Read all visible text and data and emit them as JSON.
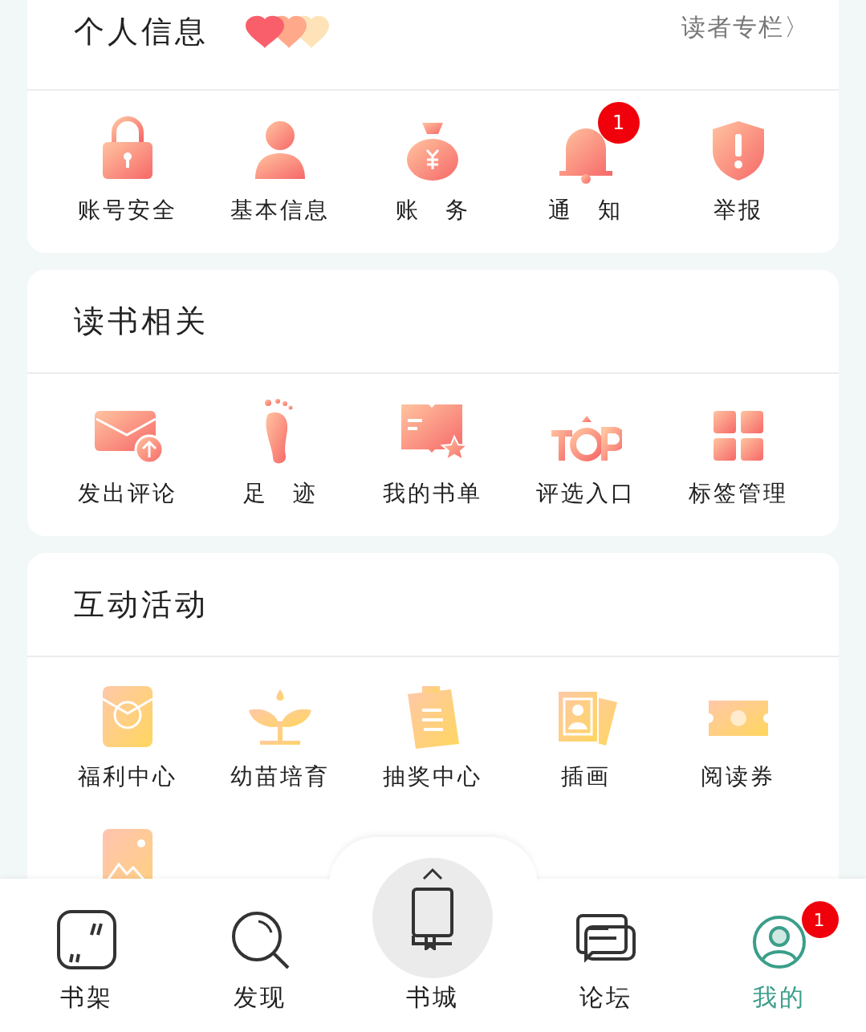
{
  "sections": [
    {
      "title": "个人信息",
      "link": "读者专栏〉",
      "items": [
        {
          "label": "账号安全"
        },
        {
          "label": "基本信息"
        },
        {
          "label": "账　务"
        },
        {
          "label": "通　知",
          "badge": "1"
        },
        {
          "label": "举报"
        }
      ]
    },
    {
      "title": "读书相关",
      "items": [
        {
          "label": "发出评论"
        },
        {
          "label": "足　迹"
        },
        {
          "label": "我的书单"
        },
        {
          "label": "评选入口"
        },
        {
          "label": "标签管理"
        }
      ]
    },
    {
      "title": "互动活动",
      "items": [
        {
          "label": "福利中心"
        },
        {
          "label": "幼苗培育"
        },
        {
          "label": "抽奖中心"
        },
        {
          "label": "插画"
        },
        {
          "label": "阅读券"
        }
      ]
    }
  ],
  "tabs": [
    {
      "label": "书架",
      "selected": false
    },
    {
      "label": "发现",
      "selected": false
    },
    {
      "label": "书城",
      "selected": false,
      "kind": "center"
    },
    {
      "label": "论坛",
      "selected": false
    },
    {
      "label": "我的",
      "selected": true,
      "badge": "1"
    }
  ]
}
